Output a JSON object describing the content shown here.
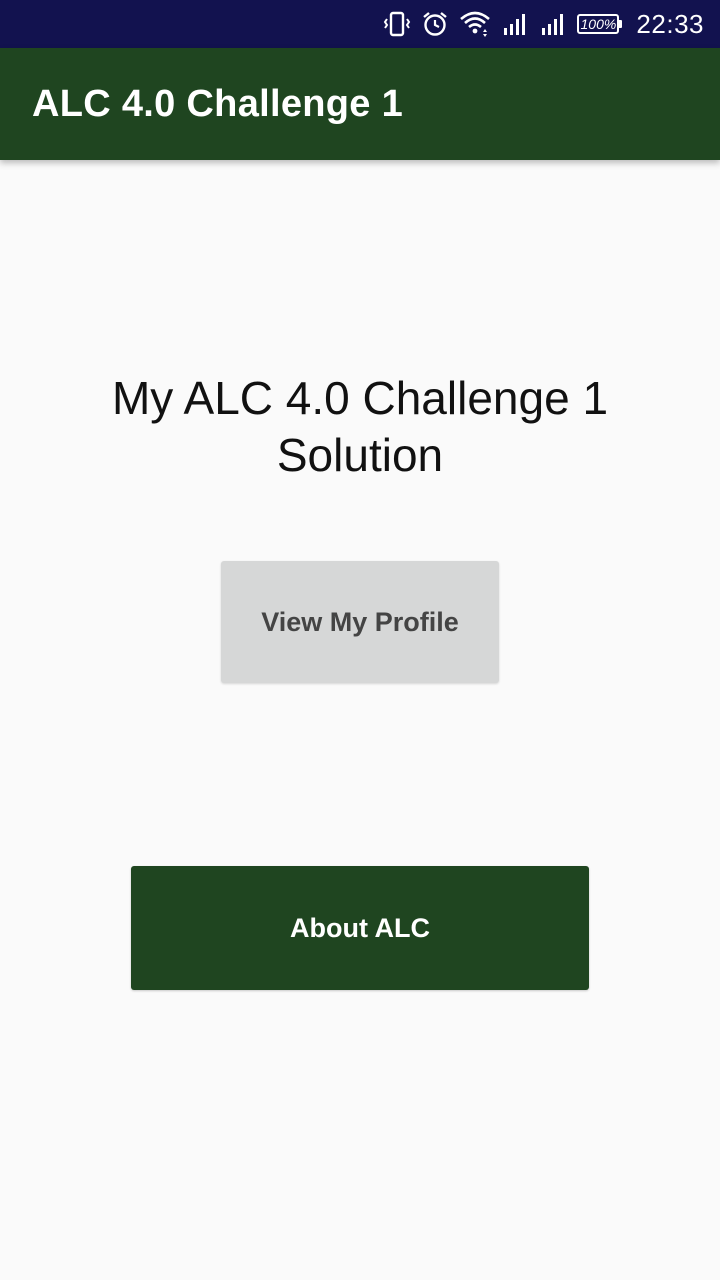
{
  "status_bar": {
    "icons": [
      "vibrate-icon",
      "alarm-icon",
      "wifi-icon",
      "signal-1-icon",
      "signal-2-icon",
      "battery-icon"
    ],
    "battery_text": "100%",
    "time": "22:33",
    "background_color": "#12124f"
  },
  "app_bar": {
    "title": "ALC 4.0 Challenge 1",
    "background_color": "#1f4520"
  },
  "main": {
    "heading": "My ALC 4.0 Challenge 1 Solution",
    "view_profile_button": "View My Profile",
    "about_button": "About ALC"
  },
  "colors": {
    "primary": "#1f4520",
    "secondary_button": "#d6d7d7",
    "background": "#fafafa"
  }
}
